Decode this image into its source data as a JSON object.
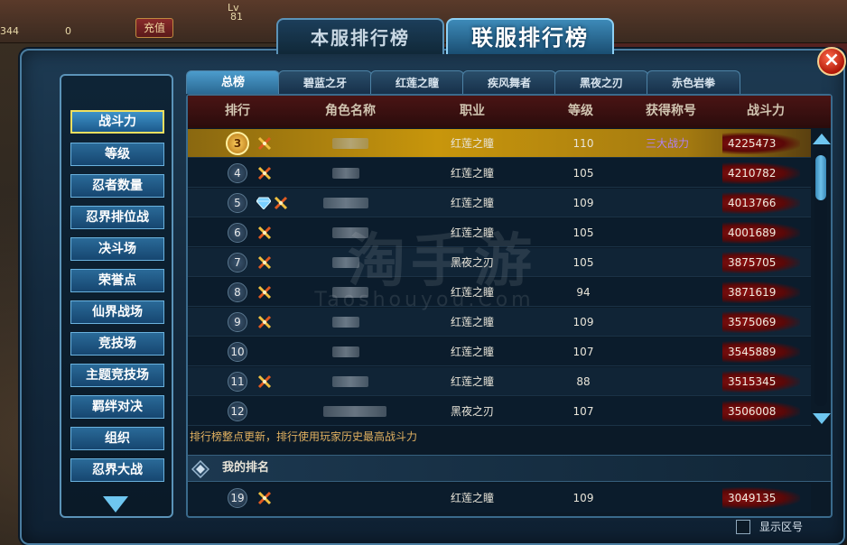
{
  "top_bar": {
    "buttons": [
      "充值"
    ],
    "gold_value": "0",
    "level_label": "Lv",
    "level_value": "81",
    "left_number": "344"
  },
  "window": {
    "tabs": [
      {
        "label": "本服排行榜",
        "active": false
      },
      {
        "label": "联服排行榜",
        "active": true
      }
    ],
    "close_label": "×"
  },
  "left_nav": {
    "items": [
      {
        "label": "战斗力",
        "active": true
      },
      {
        "label": "等级",
        "active": false
      },
      {
        "label": "忍者数量",
        "active": false
      },
      {
        "label": "忍界排位战",
        "active": false
      },
      {
        "label": "决斗场",
        "active": false
      },
      {
        "label": "荣誉点",
        "active": false
      },
      {
        "label": "仙界战场",
        "active": false
      },
      {
        "label": "竞技场",
        "active": false
      },
      {
        "label": "主题竞技场",
        "active": false
      },
      {
        "label": "羁绊对决",
        "active": false
      },
      {
        "label": "组织",
        "active": false
      },
      {
        "label": "忍界大战",
        "active": false
      }
    ]
  },
  "category_tabs": [
    {
      "label": "总榜",
      "active": true
    },
    {
      "label": "碧蓝之牙",
      "active": false
    },
    {
      "label": "红莲之瞳",
      "active": false
    },
    {
      "label": "疾风舞者",
      "active": false
    },
    {
      "label": "黑夜之刃",
      "active": false
    },
    {
      "label": "赤色岩拳",
      "active": false
    }
  ],
  "table": {
    "headers": [
      "排行",
      "角色名称",
      "职业",
      "等级",
      "获得称号",
      "战斗力"
    ],
    "rows": [
      {
        "rank": "3",
        "job": "红莲之瞳",
        "level": "110",
        "title": "三大战力",
        "power": "4225473",
        "highlight": true,
        "gem": false
      },
      {
        "rank": "4",
        "job": "红莲之瞳",
        "level": "105",
        "title": "",
        "power": "4210782",
        "highlight": false,
        "gem": false
      },
      {
        "rank": "5",
        "job": "红莲之瞳",
        "level": "109",
        "title": "",
        "power": "4013766",
        "highlight": false,
        "gem": true
      },
      {
        "rank": "6",
        "job": "红莲之瞳",
        "level": "105",
        "title": "",
        "power": "4001689",
        "highlight": false,
        "gem": false
      },
      {
        "rank": "7",
        "job": "黑夜之刃",
        "level": "105",
        "title": "",
        "power": "3875705",
        "highlight": false,
        "gem": false
      },
      {
        "rank": "8",
        "job": "红莲之瞳",
        "level": "94",
        "title": "",
        "power": "3871619",
        "highlight": false,
        "gem": false
      },
      {
        "rank": "9",
        "job": "红莲之瞳",
        "level": "109",
        "title": "",
        "power": "3575069",
        "highlight": false,
        "gem": false
      },
      {
        "rank": "10",
        "job": "红莲之瞳",
        "level": "107",
        "title": "",
        "power": "3545889",
        "highlight": false,
        "gem": false,
        "no_sword": true
      },
      {
        "rank": "11",
        "job": "红莲之瞳",
        "level": "88",
        "title": "",
        "power": "3515345",
        "highlight": false,
        "gem": false
      },
      {
        "rank": "12",
        "job": "黑夜之刃",
        "level": "107",
        "title": "",
        "power": "3506008",
        "highlight": false,
        "gem": false,
        "no_sword": true
      }
    ]
  },
  "notice": "排行榜整点更新，排行使用玩家历史最高战斗力",
  "my_rank": {
    "label": "我的排名",
    "rank": "19",
    "job": "红莲之瞳",
    "level": "109",
    "title": "",
    "power": "3049135"
  },
  "show_server": {
    "label": "显示区号",
    "checked": false
  },
  "watermark": {
    "main": "淘手游",
    "sub": "Taoshouyou.Com"
  },
  "colors": {
    "accent_blue": "#4a9ccc",
    "title_purple": "#b080f0",
    "notice_gold": "#e0b060",
    "highlight_gold": "#c8960c"
  }
}
